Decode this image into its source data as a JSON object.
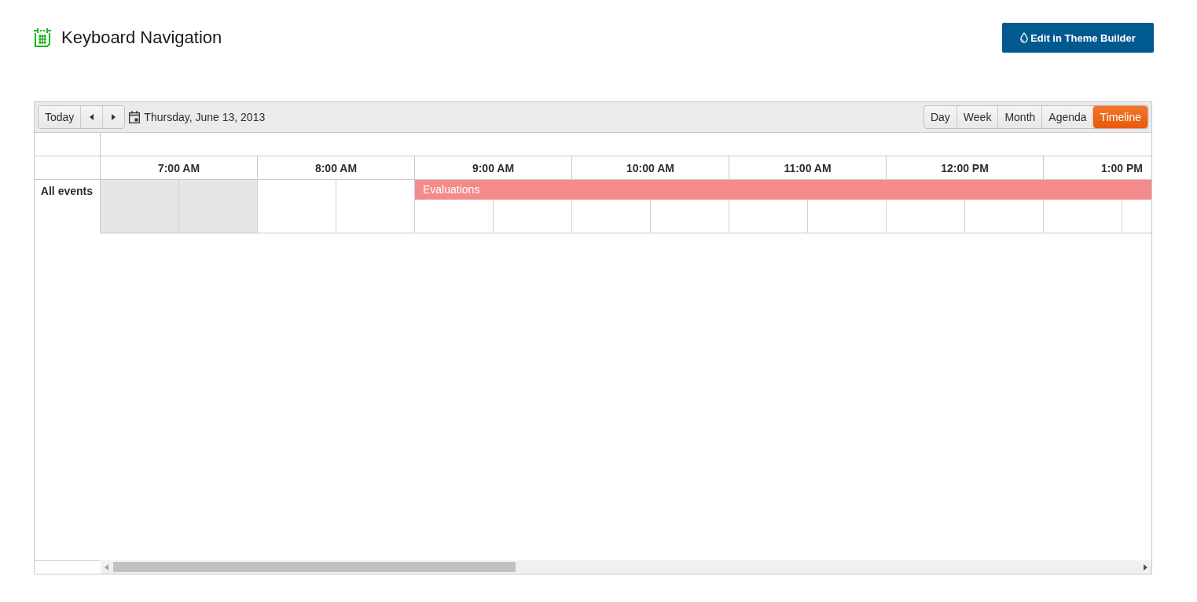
{
  "header": {
    "title": "Keyboard Navigation",
    "theme_button": "Edit in Theme Builder"
  },
  "toolbar": {
    "today_button": "Today",
    "date": "Thursday, June 13, 2013",
    "views": [
      {
        "label": "Day",
        "selected": false
      },
      {
        "label": "Week",
        "selected": false
      },
      {
        "label": "Month",
        "selected": false
      },
      {
        "label": "Agenda",
        "selected": false
      },
      {
        "label": "Timeline",
        "selected": true
      }
    ]
  },
  "timeline": {
    "group_label": "All events",
    "slots": [
      {
        "label": "7:00 AM",
        "work_hours": false
      },
      {
        "label": "8:00 AM",
        "work_hours": true
      },
      {
        "label": "9:00 AM",
        "work_hours": true,
        "events": [
          {
            "title": "Evaluations"
          }
        ]
      },
      {
        "label": "10:00 AM",
        "work_hours": true
      },
      {
        "label": "11:00 AM",
        "work_hours": true
      },
      {
        "label": "12:00 PM",
        "work_hours": true
      },
      {
        "label": "1:00 PM",
        "work_hours": true
      }
    ]
  }
}
